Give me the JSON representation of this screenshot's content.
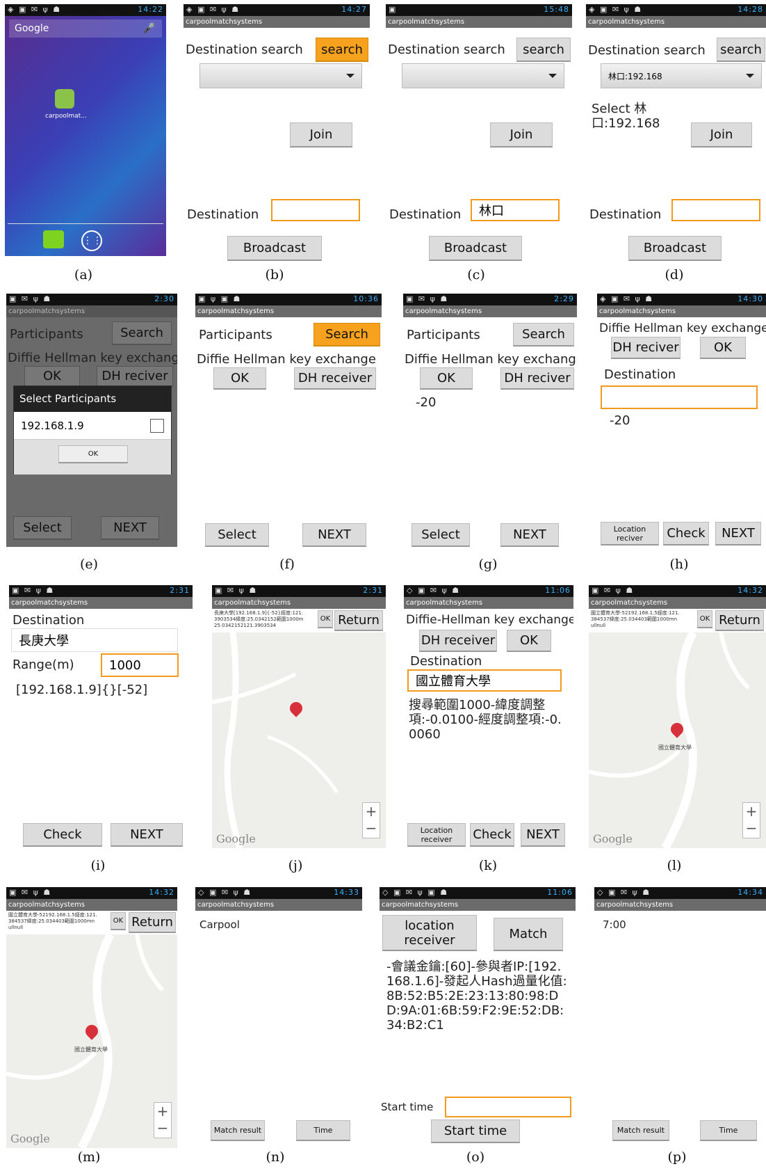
{
  "app_title": "carpoolmatchsystems",
  "captions": [
    "(a)",
    "(b)",
    "(c)",
    "(d)",
    "(e)",
    "(f)",
    "(g)",
    "(h)",
    "(i)",
    "(j)",
    "(k)",
    "(l)",
    "(m)",
    "(n)",
    "(o)",
    "(p)"
  ],
  "a": {
    "time": "14:22",
    "search_hint": "Google",
    "app_label": "carpoolmat..."
  },
  "b": {
    "time": "14:27",
    "dest_search": "Destination search",
    "search": "search",
    "join": "Join",
    "destination": "Destination",
    "dest_value": "",
    "broadcast": "Broadcast"
  },
  "c": {
    "time": "15:48",
    "dest_search": "Destination search",
    "search": "search",
    "join": "Join",
    "destination": "Destination",
    "dest_value": "林口",
    "broadcast": "Broadcast"
  },
  "d": {
    "time": "14:28",
    "dest_search": "Destination search",
    "search": "search",
    "spinner": "林口:192.168",
    "select_text": "Select 林口:192.168",
    "join": "Join",
    "destination": "Destination",
    "dest_value": "",
    "broadcast": "Broadcast"
  },
  "e": {
    "time": "2:30",
    "participants": "Participants",
    "search": "Search",
    "dh": "Diffie Hellman key exchange",
    "ok": "OK",
    "dh_receiver": "DH reciver",
    "dialog_title": "Select Participants",
    "dialog_item": "192.168.1.9",
    "dialog_ok": "OK",
    "select": "Select",
    "next": "NEXT"
  },
  "f": {
    "time": "10:36",
    "participants": "Participants",
    "search": "Search",
    "dh": "Diffie Hellman key exchange",
    "ok": "OK",
    "dh_receiver": "DH receiver",
    "select": "Select",
    "next": "NEXT"
  },
  "g": {
    "time": "2:29",
    "participants": "Participants",
    "search": "Search",
    "dh": "Diffie Hellman key exchange",
    "ok": "OK",
    "dh_receiver": "DH reciver",
    "value": "-20",
    "select": "Select",
    "next": "NEXT"
  },
  "h": {
    "time": "14:30",
    "dh": "Diffie Hellman key exchange",
    "dh_receiver": "DH reciver",
    "ok": "OK",
    "destination": "Destination",
    "dest_value": "",
    "value": "-20",
    "location_receiver": "Location reciver",
    "check": "Check",
    "next": "NEXT"
  },
  "i": {
    "time": "2:31",
    "destination": "Destination",
    "dest_value": "長庚大學",
    "range": "Range(m)",
    "range_value": "1000",
    "result": "[192.168.1.9]{}[-52]",
    "check": "Check",
    "next": "NEXT"
  },
  "j": {
    "time": "2:31",
    "info": "長庚大學[192.168.1.9]{-52}經度:121.3903534緯度:25.0342152範圍1000m25.0342152121.3903534",
    "ok": "OK",
    "return": "Return"
  },
  "k": {
    "time": "11:06",
    "dh": "Diffie-Hellman key exchange",
    "dh_receiver": "DH receiver",
    "ok": "OK",
    "destination": "Destination",
    "dest_value": "國立體育大學",
    "result": "搜尋範圍1000-緯度調整項:-0.0100-經度調整項:-0.0060",
    "location_receiver": "Location receiver",
    "check": "Check",
    "next": "NEXT"
  },
  "l": {
    "time": "14:32",
    "info": "國立體育大學-52192.168.1.5經度:121.384537緯度:25.034403範圍1000mnullnull",
    "ok": "OK",
    "return": "Return",
    "place": "國立體育大學"
  },
  "m": {
    "time": "14:32",
    "info": "國立體育大學-52192.168.1.5經度:121.384537緯度:25.034403範圍1000mnullnull",
    "ok": "OK",
    "return": "Return",
    "place": "國立體育大學"
  },
  "n": {
    "time": "14:33",
    "carpool": "Carpool",
    "match_result": "Match result",
    "time_btn": "Time"
  },
  "o": {
    "time": "11:06",
    "location_receiver": "location receiver",
    "match": "Match",
    "result": "-會議金鑰:[60]-參與者IP:[192.168.1.6]-發起人Hash過量化值:8B:52:B5:2E:23:13:80:98:DD:9A:01:6B:59:F2:9E:52:DB:34:B2:C1",
    "start_time_label": "Start time",
    "start_time_value": "",
    "start_time_btn": "Start time"
  },
  "p": {
    "time": "14:34",
    "time_value": "7:00",
    "match_result": "Match result",
    "time_btn": "Time"
  }
}
